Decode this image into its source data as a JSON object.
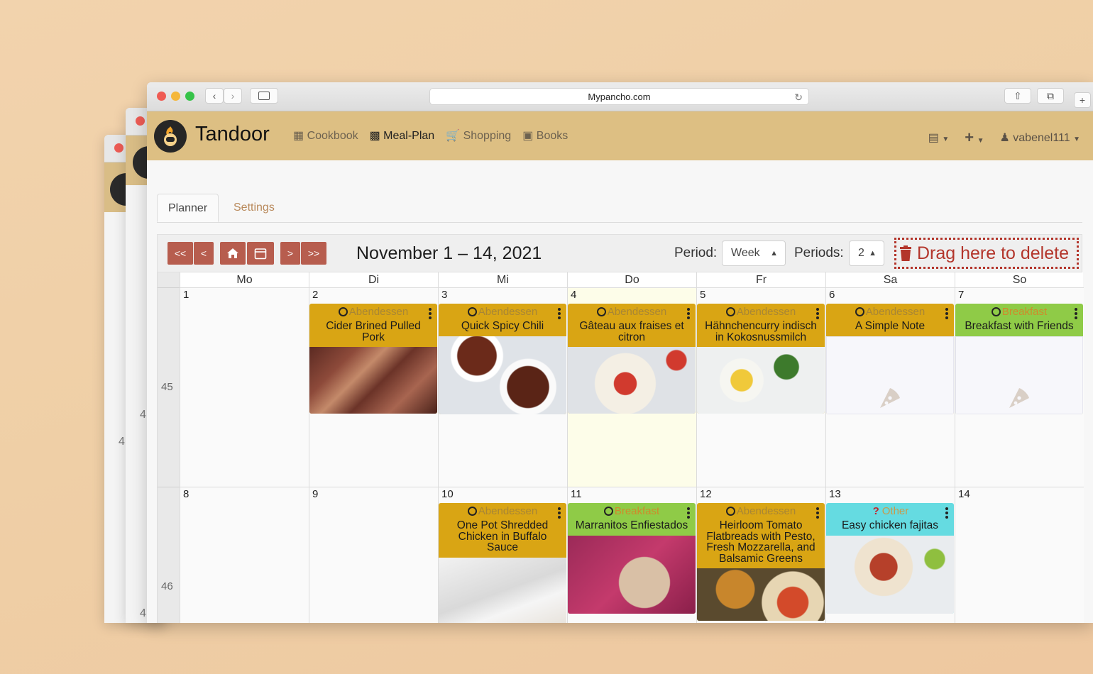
{
  "browser": {
    "url": "Mypancho.com"
  },
  "background_windows": {
    "week_labels": [
      "4",
      "4",
      "4"
    ]
  },
  "app": {
    "brand": "Tandoor",
    "nav": [
      {
        "label": "Cookbook",
        "icon": "book-icon",
        "active": false
      },
      {
        "label": "Meal-Plan",
        "icon": "calendar-icon",
        "active": true
      },
      {
        "label": "Shopping",
        "icon": "cart-icon",
        "active": false
      },
      {
        "label": "Books",
        "icon": "open-book-icon",
        "active": false
      }
    ],
    "user": "vabenel111"
  },
  "tabs": [
    {
      "label": "Planner",
      "active": true
    },
    {
      "label": "Settings",
      "active": false
    }
  ],
  "toolbar": {
    "date_range": "November 1 – 14, 2021",
    "period_label": "Period:",
    "period_value": "Week",
    "periods_label": "Periods:",
    "periods_value": "2",
    "delete_zone": "Drag here to delete",
    "nav_buttons": [
      "<<",
      "<",
      "home",
      "calendar",
      ">",
      ">>"
    ]
  },
  "calendar": {
    "day_headers": [
      "Mo",
      "Di",
      "Mi",
      "Do",
      "Fr",
      "Sa",
      "So"
    ],
    "weeks": [
      {
        "number": "45",
        "days": [
          "1",
          "2",
          "3",
          "4",
          "5",
          "6",
          "7"
        ],
        "today_index": 3,
        "entries": [
          {
            "day": 1,
            "type": "Abendessen",
            "title": "Cider Brined Pulled Pork",
            "color": "orange",
            "image": "pulled-pork"
          },
          {
            "day": 2,
            "type": "Abendessen",
            "title": "Quick Spicy Chili",
            "color": "orange",
            "image": "chili"
          },
          {
            "day": 3,
            "type": "Abendessen",
            "title": "Gâteau aux fraises et citron",
            "color": "orange",
            "image": "cake"
          },
          {
            "day": 4,
            "type": "Abendessen",
            "title": "Hähnchencurry indisch in Kokosnussmilch",
            "color": "orange",
            "image": "curry"
          },
          {
            "day": 5,
            "type": "Abendessen",
            "title": "A Simple Note",
            "color": "orange",
            "image": "placeholder"
          },
          {
            "day": 6,
            "type": "Breakfast",
            "title": "Breakfast with Friends",
            "color": "green",
            "image": "placeholder"
          }
        ]
      },
      {
        "number": "46",
        "days": [
          "8",
          "9",
          "10",
          "11",
          "12",
          "13",
          "14"
        ],
        "today_index": -1,
        "entries": [
          {
            "day": 2,
            "type": "Abendessen",
            "title": "One Pot Shredded Chicken in Buffalo Sauce",
            "color": "orange",
            "image": "fork"
          },
          {
            "day": 3,
            "type": "Breakfast",
            "title": "Marranitos Enfiestados",
            "color": "green",
            "image": "sprinkles"
          },
          {
            "day": 4,
            "type": "Abendessen",
            "title": "Heirloom Tomato Flatbreads with Pesto, Fresh Mozzarella, and Balsamic Greens",
            "color": "orange",
            "image": "flatbread"
          },
          {
            "day": 5,
            "type": "Other",
            "title": "Easy chicken fajitas",
            "color": "cyan",
            "image": "fajitas"
          }
        ]
      }
    ]
  }
}
